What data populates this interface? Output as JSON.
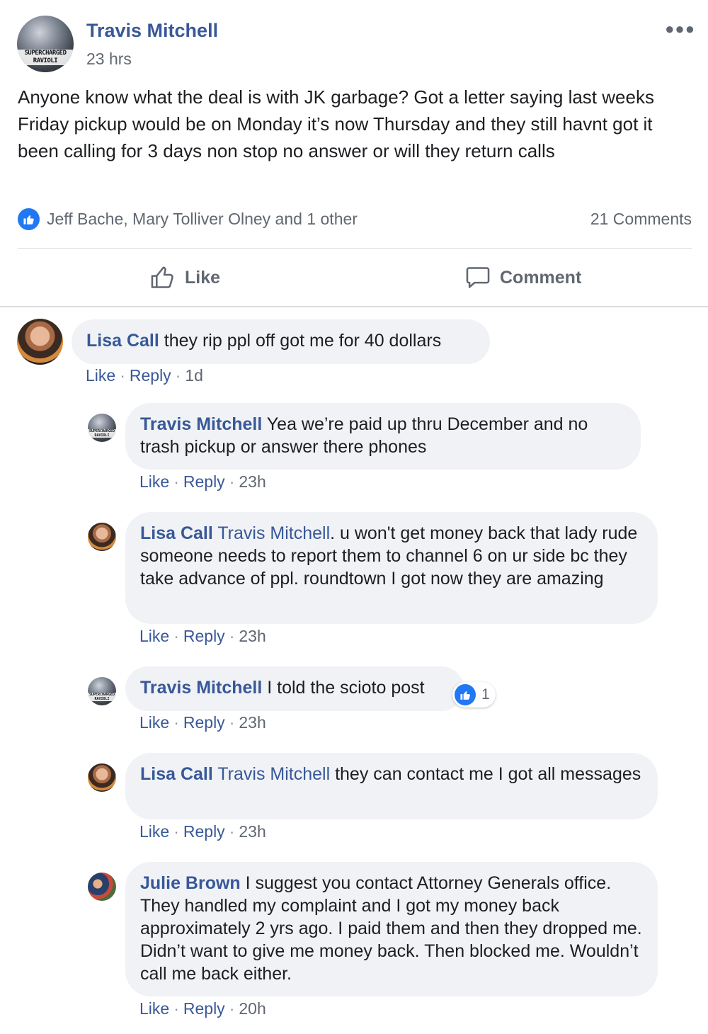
{
  "post": {
    "author": "Travis Mitchell",
    "avatar_text": "SUPERCHARGED RAVIOLI",
    "time": "23 hrs",
    "more_icon": "more-horizontal-icon",
    "text": "Anyone know what the deal is with JK garbage? Got a letter saying last weeks Friday pickup would be on Monday it’s now Thursday and they still havnt got it been calling for 3 days non stop no answer or will they return calls",
    "reactions": "Jeff Bache, Mary Tolliver Olney and 1 other",
    "comment_count": "21 Comments",
    "like_label": "Like",
    "comment_label": "Comment"
  },
  "comments": [
    {
      "author": "Lisa Call",
      "mention": "",
      "text": " they rip ppl off got me for 40 dollars",
      "like": "Like",
      "reply": "Reply",
      "time": "1d"
    },
    {
      "author": "Travis Mitchell",
      "mention": "",
      "text": " Yea we’re paid up thru December and no trash pickup or answer there phones",
      "like": "Like",
      "reply": "Reply",
      "time": "23h"
    },
    {
      "author": "Lisa Call",
      "mention": " Travis Mitchell",
      "text": ". u won't get money back that lady rude someone needs to report them to channel 6 on ur side bc they take advance of ppl. roundtown I got now they are amazing",
      "like": "Like",
      "reply": "Reply",
      "time": "23h"
    },
    {
      "author": "Travis Mitchell",
      "mention": "",
      "text": " I told the scioto post",
      "like": "Like",
      "reply": "Reply",
      "time": "23h",
      "reaction_count": "1"
    },
    {
      "author": "Lisa Call",
      "mention": " Travis Mitchell",
      "text": " they can contact me I got all messages",
      "like": "Like",
      "reply": "Reply",
      "time": "23h"
    },
    {
      "author": "Julie Brown",
      "mention": "",
      "text": " I suggest you contact Attorney Generals office. They handled my complaint and I got my money back approximately 2 yrs ago. I paid them and then they dropped me. Didn’t want to give me money back. Then blocked me. Wouldn’t call me back either.",
      "like": "Like",
      "reply": "Reply",
      "time": "20h"
    }
  ],
  "colors": {
    "link": "#385898",
    "secondary": "#606770",
    "bubble": "#f0f2f5",
    "like_blue": "#2078f4"
  }
}
